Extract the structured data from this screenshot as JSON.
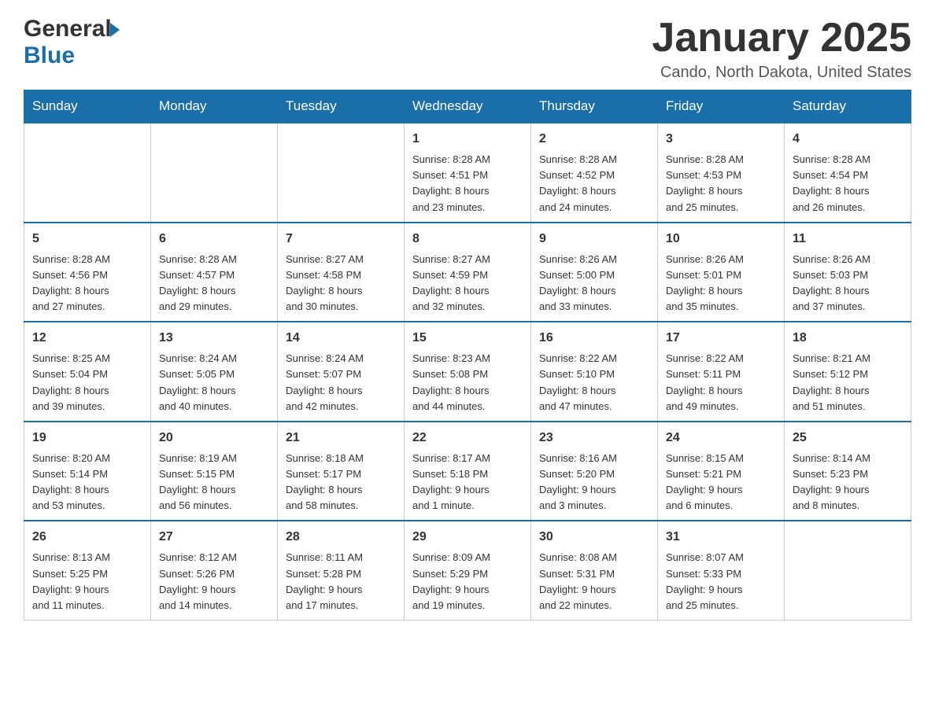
{
  "header": {
    "logo_general": "General",
    "logo_blue": "Blue",
    "month_title": "January 2025",
    "location": "Cando, North Dakota, United States"
  },
  "weekdays": [
    "Sunday",
    "Monday",
    "Tuesday",
    "Wednesday",
    "Thursday",
    "Friday",
    "Saturday"
  ],
  "weeks": [
    [
      {
        "day": "",
        "info": ""
      },
      {
        "day": "",
        "info": ""
      },
      {
        "day": "",
        "info": ""
      },
      {
        "day": "1",
        "info": "Sunrise: 8:28 AM\nSunset: 4:51 PM\nDaylight: 8 hours\nand 23 minutes."
      },
      {
        "day": "2",
        "info": "Sunrise: 8:28 AM\nSunset: 4:52 PM\nDaylight: 8 hours\nand 24 minutes."
      },
      {
        "day": "3",
        "info": "Sunrise: 8:28 AM\nSunset: 4:53 PM\nDaylight: 8 hours\nand 25 minutes."
      },
      {
        "day": "4",
        "info": "Sunrise: 8:28 AM\nSunset: 4:54 PM\nDaylight: 8 hours\nand 26 minutes."
      }
    ],
    [
      {
        "day": "5",
        "info": "Sunrise: 8:28 AM\nSunset: 4:56 PM\nDaylight: 8 hours\nand 27 minutes."
      },
      {
        "day": "6",
        "info": "Sunrise: 8:28 AM\nSunset: 4:57 PM\nDaylight: 8 hours\nand 29 minutes."
      },
      {
        "day": "7",
        "info": "Sunrise: 8:27 AM\nSunset: 4:58 PM\nDaylight: 8 hours\nand 30 minutes."
      },
      {
        "day": "8",
        "info": "Sunrise: 8:27 AM\nSunset: 4:59 PM\nDaylight: 8 hours\nand 32 minutes."
      },
      {
        "day": "9",
        "info": "Sunrise: 8:26 AM\nSunset: 5:00 PM\nDaylight: 8 hours\nand 33 minutes."
      },
      {
        "day": "10",
        "info": "Sunrise: 8:26 AM\nSunset: 5:01 PM\nDaylight: 8 hours\nand 35 minutes."
      },
      {
        "day": "11",
        "info": "Sunrise: 8:26 AM\nSunset: 5:03 PM\nDaylight: 8 hours\nand 37 minutes."
      }
    ],
    [
      {
        "day": "12",
        "info": "Sunrise: 8:25 AM\nSunset: 5:04 PM\nDaylight: 8 hours\nand 39 minutes."
      },
      {
        "day": "13",
        "info": "Sunrise: 8:24 AM\nSunset: 5:05 PM\nDaylight: 8 hours\nand 40 minutes."
      },
      {
        "day": "14",
        "info": "Sunrise: 8:24 AM\nSunset: 5:07 PM\nDaylight: 8 hours\nand 42 minutes."
      },
      {
        "day": "15",
        "info": "Sunrise: 8:23 AM\nSunset: 5:08 PM\nDaylight: 8 hours\nand 44 minutes."
      },
      {
        "day": "16",
        "info": "Sunrise: 8:22 AM\nSunset: 5:10 PM\nDaylight: 8 hours\nand 47 minutes."
      },
      {
        "day": "17",
        "info": "Sunrise: 8:22 AM\nSunset: 5:11 PM\nDaylight: 8 hours\nand 49 minutes."
      },
      {
        "day": "18",
        "info": "Sunrise: 8:21 AM\nSunset: 5:12 PM\nDaylight: 8 hours\nand 51 minutes."
      }
    ],
    [
      {
        "day": "19",
        "info": "Sunrise: 8:20 AM\nSunset: 5:14 PM\nDaylight: 8 hours\nand 53 minutes."
      },
      {
        "day": "20",
        "info": "Sunrise: 8:19 AM\nSunset: 5:15 PM\nDaylight: 8 hours\nand 56 minutes."
      },
      {
        "day": "21",
        "info": "Sunrise: 8:18 AM\nSunset: 5:17 PM\nDaylight: 8 hours\nand 58 minutes."
      },
      {
        "day": "22",
        "info": "Sunrise: 8:17 AM\nSunset: 5:18 PM\nDaylight: 9 hours\nand 1 minute."
      },
      {
        "day": "23",
        "info": "Sunrise: 8:16 AM\nSunset: 5:20 PM\nDaylight: 9 hours\nand 3 minutes."
      },
      {
        "day": "24",
        "info": "Sunrise: 8:15 AM\nSunset: 5:21 PM\nDaylight: 9 hours\nand 6 minutes."
      },
      {
        "day": "25",
        "info": "Sunrise: 8:14 AM\nSunset: 5:23 PM\nDaylight: 9 hours\nand 8 minutes."
      }
    ],
    [
      {
        "day": "26",
        "info": "Sunrise: 8:13 AM\nSunset: 5:25 PM\nDaylight: 9 hours\nand 11 minutes."
      },
      {
        "day": "27",
        "info": "Sunrise: 8:12 AM\nSunset: 5:26 PM\nDaylight: 9 hours\nand 14 minutes."
      },
      {
        "day": "28",
        "info": "Sunrise: 8:11 AM\nSunset: 5:28 PM\nDaylight: 9 hours\nand 17 minutes."
      },
      {
        "day": "29",
        "info": "Sunrise: 8:09 AM\nSunset: 5:29 PM\nDaylight: 9 hours\nand 19 minutes."
      },
      {
        "day": "30",
        "info": "Sunrise: 8:08 AM\nSunset: 5:31 PM\nDaylight: 9 hours\nand 22 minutes."
      },
      {
        "day": "31",
        "info": "Sunrise: 8:07 AM\nSunset: 5:33 PM\nDaylight: 9 hours\nand 25 minutes."
      },
      {
        "day": "",
        "info": ""
      }
    ]
  ]
}
